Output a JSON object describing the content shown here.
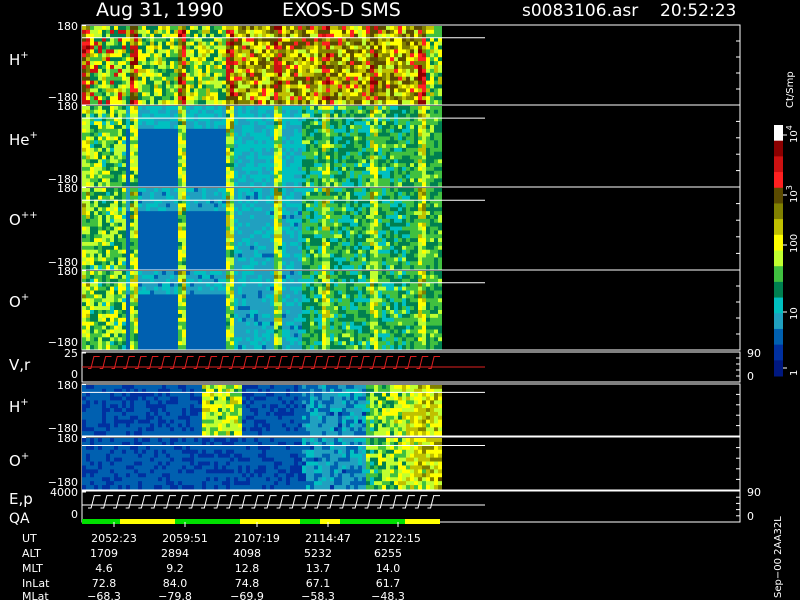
{
  "header": {
    "date": "Aug 31, 1990",
    "instrument": "EXOS-D SMS",
    "file": "s0083106.asr",
    "time": "20:52:23"
  },
  "colors": {
    "background": "#000000",
    "axes": "#ffffff",
    "velocity_trace": "#e02020",
    "qa_good": "#00e000",
    "qa_warn": "#ffff00"
  },
  "chart_data": [
    {
      "type": "heatmap",
      "name": "H+ pitch-angle spectrogram",
      "ylabel": "H",
      "ylabel_sup": "+",
      "yticks": [
        "180",
        "−180"
      ],
      "ylim": [
        -180,
        180
      ],
      "data_fraction_of_x": 0.84
    },
    {
      "type": "heatmap",
      "name": "He+ pitch-angle spectrogram",
      "ylabel": "He",
      "ylabel_sup": "+",
      "yticks": [
        "180",
        "−180"
      ],
      "ylim": [
        -180,
        180
      ],
      "data_fraction_of_x": 0.84
    },
    {
      "type": "heatmap",
      "name": "O++ pitch-angle spectrogram",
      "ylabel": "O",
      "ylabel_sup": "++",
      "yticks": [
        "180",
        "−180"
      ],
      "ylim": [
        -180,
        180
      ],
      "data_fraction_of_x": 0.84
    },
    {
      "type": "heatmap",
      "name": "O+ pitch-angle spectrogram",
      "ylabel": "O",
      "ylabel_sup": "+",
      "yticks": [
        "180",
        "−180"
      ],
      "ylim": [
        -180,
        180
      ],
      "data_fraction_of_x": 0.84
    },
    {
      "type": "line",
      "name": "V,r sweep",
      "ylabel": "V,r",
      "yticks": [
        "25",
        "0"
      ],
      "right_ticks": [
        "90",
        "0"
      ],
      "ylim": [
        0,
        25
      ],
      "sweep_count": 30
    },
    {
      "type": "heatmap",
      "name": "H+ (second mode) spectrogram",
      "ylabel": "H",
      "ylabel_sup": "+",
      "yticks": [
        "180",
        "−180"
      ],
      "ylim": [
        -180,
        180
      ]
    },
    {
      "type": "heatmap",
      "name": "O+ (second mode) spectrogram",
      "ylabel": "O",
      "ylabel_sup": "+",
      "yticks": [
        "180",
        "−180"
      ],
      "ylim": [
        -180,
        180
      ]
    },
    {
      "type": "line",
      "name": "E,p / QA",
      "ylabel": "E,p",
      "ylabel2": "QA",
      "yticks": [
        "4000",
        "0"
      ],
      "right_ticks": [
        "90",
        "0"
      ],
      "ylim": [
        0,
        4000
      ],
      "step_count": 28
    }
  ],
  "colorbar": {
    "unit": "Ct/Smp",
    "scale": "log",
    "tick_labels": [
      "10",
      "4",
      "10",
      "3",
      "100",
      "10",
      "1"
    ],
    "ticks": [
      {
        "base": "10",
        "exp": "4",
        "value": 10000
      },
      {
        "base": "10",
        "exp": "3",
        "value": 1000
      },
      {
        "base": "100",
        "exp": "",
        "value": 100
      },
      {
        "base": "10",
        "exp": "",
        "value": 10
      },
      {
        "base": "1",
        "exp": "",
        "value": 1
      }
    ],
    "stops": [
      "#ffffff",
      "#8b0000",
      "#cc1111",
      "#ff2020",
      "#5a4a00",
      "#808000",
      "#c0c000",
      "#ffff00",
      "#c0ff30",
      "#40c040",
      "#008050",
      "#00c0c0",
      "#20a0c0",
      "#0060b0",
      "#0030a0",
      "#001880"
    ]
  },
  "footer": {
    "row_labels": [
      "UT",
      "ALT",
      "MLT",
      "InLat",
      "MLat"
    ],
    "columns": [
      {
        "UT": "2052:23",
        "ALT": "1709",
        "MLT": "4.6",
        "InLat": "72.8",
        "MLat": "−68.3"
      },
      {
        "UT": "2059:51",
        "ALT": "2894",
        "MLT": "9.2",
        "InLat": "84.0",
        "MLat": "−79.8"
      },
      {
        "UT": "2107:19",
        "ALT": "4098",
        "MLT": "12.8",
        "InLat": "74.8",
        "MLat": "−69.9"
      },
      {
        "UT": "2114:47",
        "ALT": "5232",
        "MLT": "13.7",
        "InLat": "67.1",
        "MLat": "−58.3"
      },
      {
        "UT": "2122:15",
        "ALT": "6255",
        "MLT": "14.0",
        "InLat": "61.7",
        "MLat": "−48.3"
      }
    ],
    "version": "Sep−00  2AA32L"
  }
}
